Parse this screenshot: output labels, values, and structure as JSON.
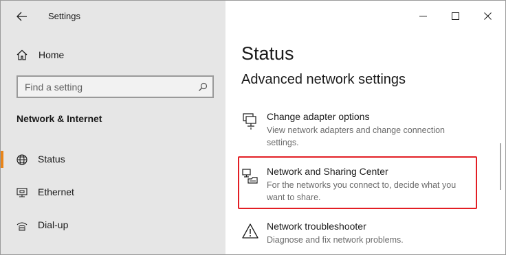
{
  "window": {
    "title": "Settings",
    "controls": {
      "minimize_icon": "minimize-icon",
      "maximize_icon": "maximize-icon",
      "close_icon": "close-icon"
    }
  },
  "sidebar": {
    "home_label": "Home",
    "search_placeholder": "Find a setting",
    "section_title": "Network & Internet",
    "items": [
      {
        "label": "Status",
        "icon": "globe-icon",
        "active": true
      },
      {
        "label": "Ethernet",
        "icon": "ethernet-monitor-icon",
        "active": false
      },
      {
        "label": "Dial-up",
        "icon": "dial-up-icon",
        "active": false
      }
    ]
  },
  "main": {
    "title": "Status",
    "subtitle": "Advanced network settings",
    "entries": [
      {
        "name": "Change adapter options",
        "desc": "View network adapters and change connection settings.",
        "icon": "network-adapter-icon"
      },
      {
        "name": "Network and Sharing Center",
        "desc": "For the networks you connect to, decide what you want to share.",
        "icon": "sharing-center-icon",
        "highlighted": true
      },
      {
        "name": "Network troubleshooter",
        "desc": "Diagnose and fix network problems.",
        "icon": "warning-icon"
      }
    ]
  },
  "colors": {
    "accent": "#e8851a",
    "highlight_border": "#e31e24",
    "sidebar_bg": "#e6e6e6"
  }
}
